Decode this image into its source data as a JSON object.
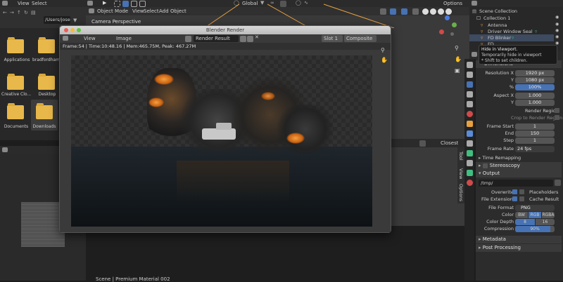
{
  "filebrowser": {
    "menu_view": "View",
    "menu_select": "Select",
    "path_left": "/Users/joseph",
    "folders": [
      {
        "name": "Applications"
      },
      {
        "name": "bradfordham..."
      },
      {
        "name": "Creative Clo..."
      },
      {
        "name": "Desktop"
      },
      {
        "name": "Documents"
      },
      {
        "name": "Downloads"
      }
    ]
  },
  "viewport": {
    "mode": "Object Mode",
    "menu_view": "View",
    "menu_select": "Select",
    "menu_add": "Add",
    "menu_object": "Object",
    "label": "Camera Perspective",
    "orientation": "Global",
    "bottom_text": "Scene | Premium Material 002"
  },
  "top": {
    "options": "Options"
  },
  "render_window": {
    "title": "Blender Render",
    "menu_view": "View",
    "menu_image": "Image",
    "image_name": "Render Result",
    "slot": "Slot 1",
    "pass": "Composite",
    "stats": "Frame:54 | Time:10:48.16 | Mem:465.75M, Peak: 467.27M"
  },
  "outliner": {
    "title": "Scene Collection",
    "rows": [
      {
        "label": "Collection 1"
      },
      {
        "label": "Antenna"
      },
      {
        "label": "Driver Window Seal"
      },
      {
        "label": "FD Blinker"
      },
      {
        "label": "FD..."
      }
    ],
    "tooltip": {
      "line1": "Hide in Viewport.",
      "line2": "Temporarily hide in viewport",
      "line3": "* Shift to set children."
    }
  },
  "side_tabs": {
    "tool": "Tool",
    "view": "View",
    "options": "Options"
  },
  "properties": {
    "dimensions_label": "Dimensions",
    "resolution_x_label": "Resolution X",
    "resolution_x": "1920 px",
    "resolution_y_label": "Y",
    "resolution_y": "1080 px",
    "percent_label": "%",
    "percent": "100%",
    "aspect_x_label": "Aspect X",
    "aspect_x": "1.000",
    "aspect_y_label": "Y",
    "aspect_y": "1.000",
    "render_region": "Render Region",
    "crop_region": "Crop to Render Region",
    "frame_start_label": "Frame Start",
    "frame_start": "1",
    "frame_end_label": "End",
    "frame_end": "150",
    "frame_step_label": "Step",
    "frame_step": "1",
    "frame_rate_label": "Frame Rate",
    "frame_rate": "24 fps",
    "time_remapping": "Time Remapping",
    "stereoscopy": "Stereoscopy",
    "output_label": "Output",
    "output_path": "/tmp/",
    "overwrite": "Overwrite",
    "placeholders": "Placeholders",
    "file_extensions": "File Extensions",
    "cache_result": "Cache Result",
    "file_format_label": "File Format",
    "file_format": "PNG",
    "color_label": "Color",
    "color_bw": "BW",
    "color_rgb": "RGB",
    "color_rgba": "RGBA",
    "color_depth_label": "Color Depth",
    "depth_8": "8",
    "depth_16": "16",
    "compression_label": "Compression",
    "compression": "90%",
    "compression_value": 0.9,
    "metadata": "Metadata",
    "post_processing": "Post Processing"
  },
  "lower_panel": {
    "closest": "Closest"
  },
  "colors": {
    "accent": "#4772b3",
    "folder": "#e8b84a",
    "orange_link": "#e8a040",
    "green_icon": "#3fbf80"
  }
}
